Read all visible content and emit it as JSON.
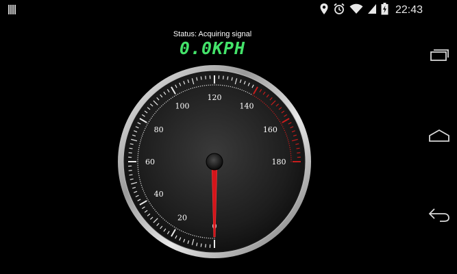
{
  "status_bar": {
    "time": "22:43",
    "icons": [
      "notification-bars-icon",
      "location-icon",
      "alarm-icon",
      "wifi-icon",
      "cell-signal-icon",
      "battery-charging-icon"
    ]
  },
  "app": {
    "status_text": "Status: Acquiring signal",
    "speed_text": "0.0KPH"
  },
  "gauge": {
    "min": 0,
    "max": 180,
    "labels": [
      "0",
      "20",
      "40",
      "60",
      "80",
      "100",
      "120",
      "140",
      "160",
      "180"
    ],
    "current_value": 0,
    "redline_start": 140,
    "colors": {
      "needle": "#d4141a",
      "redline": "#c81d1d",
      "readout": "#44e36a"
    }
  },
  "nav_bar": {
    "buttons": [
      "recent-apps-icon",
      "home-icon",
      "back-icon"
    ]
  }
}
